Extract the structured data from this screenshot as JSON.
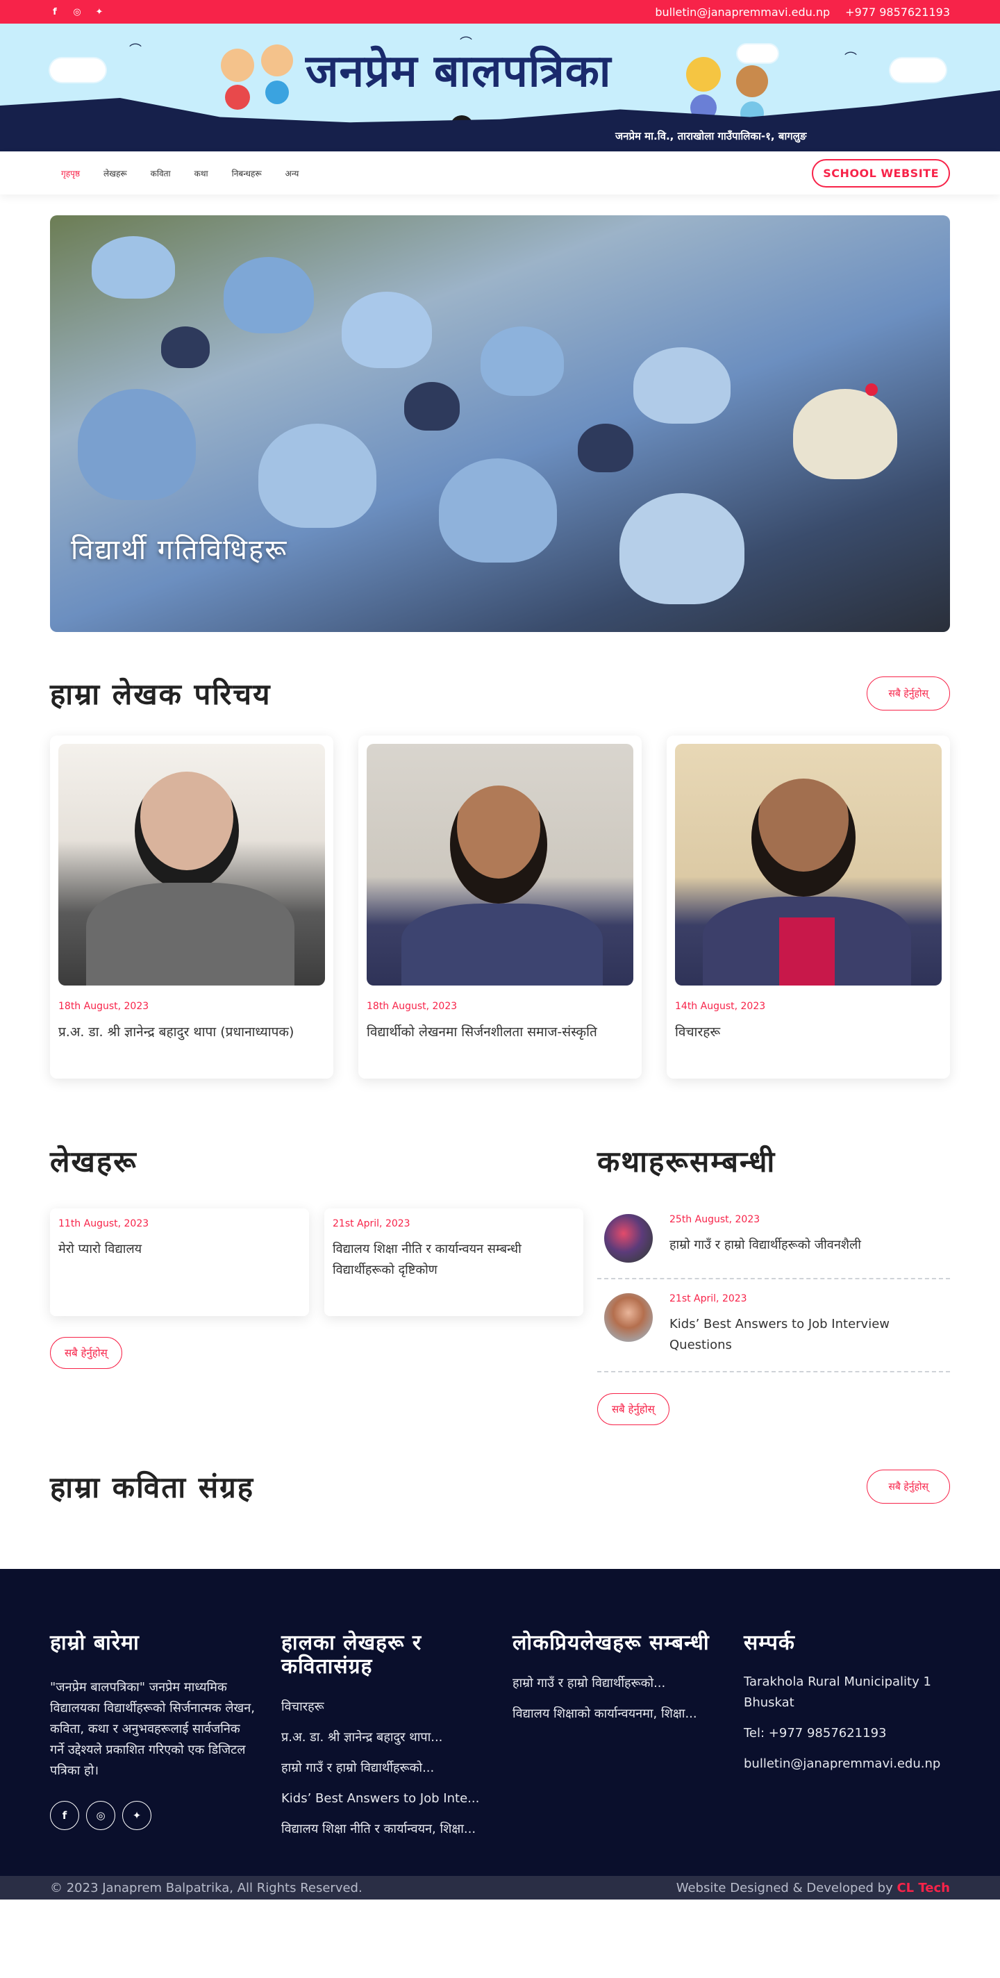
{
  "topbar": {
    "email": "bulletin@janapremmavi.edu.np",
    "phone": "+977 9857621193",
    "social_icons": [
      "facebook-icon",
      "instagram-icon",
      "twitter-icon"
    ]
  },
  "banner": {
    "title": "जनप्रेम बालपत्रिका",
    "subtitle": "जनप्रेम मा.वि., ताराखोला गाउँपालिका-१, बागलुङ"
  },
  "nav": {
    "items": [
      "गृहपृष्ठ",
      "लेखहरू",
      "कविता",
      "कथा",
      "निबन्धहरू",
      "अन्य"
    ],
    "active_index": 0,
    "school_button": "SCHOOL WEBSITE"
  },
  "hero": {
    "title": "विद्यार्थी गतिविधिहरू"
  },
  "featured": {
    "heading": "हाम्रा लेखक परिचय",
    "view_all": "सबै हेर्नुहोस्",
    "cards": [
      {
        "date": "18th August, 2023",
        "title": "प्र.अ. डा. श्री ज्ञानेन्द्र बहादुर थापा (प्रधानाध्यापक)"
      },
      {
        "date": "18th August, 2023",
        "title": "विद्यार्थीको लेखनमा सिर्जनशीलता समाज-संस्कृति"
      },
      {
        "date": "14th August, 2023",
        "title": "विचारहरू"
      }
    ]
  },
  "articles": {
    "heading": "लेखहरू",
    "view_all": "सबै हेर्नुहोस्",
    "cards": [
      {
        "date": "11th August, 2023",
        "title": "मेरो प्यारो विद्यालय"
      },
      {
        "date": "21st April, 2023",
        "title": "विद्यालय शिक्षा नीति र कार्यान्वयन सम्बन्धी विद्यार्थीहरूको दृष्टिकोण"
      }
    ]
  },
  "stories": {
    "heading": "कथाहरूसम्बन्धी",
    "view_all": "सबै हेर्नुहोस्",
    "items": [
      {
        "date": "25th August, 2023",
        "title": "हाम्रो गाउँ र हाम्रो विद्यार्थीहरूको जीवनशैली"
      },
      {
        "date": "21st April, 2023",
        "title": "Kids’ Best Answers to Job Interview Questions"
      }
    ]
  },
  "poems": {
    "heading": "हाम्रा कविता संग्रह",
    "view_all": "सबै हेर्नुहोस्"
  },
  "footer": {
    "about_heading": "हाम्रो बारेमा",
    "about_text": "\"जनप्रेम बालपत्रिका\" जनप्रेम माध्यमिक विद्यालयका विद्यार्थीहरूको सिर्जनात्मक लेखन, कविता, कथा र अनुभवहरूलाई सार्वजनिक गर्ने उद्देश्यले प्रकाशित गरिएको एक डिजिटल पत्रिका हो।",
    "social_icons": [
      "facebook-icon",
      "instagram-icon",
      "twitter-icon"
    ],
    "recent_heading": "हालका लेखहरू र कवितासंग्रह",
    "recent_links": [
      "विचारहरू",
      "प्र.अ. डा. श्री ज्ञानेन्द्र बहादुर थापा...",
      "हाम्रो गाउँ र हाम्रो विद्यार्थीहरूको...",
      "Kids’ Best Answers to Job Inte...",
      "विद्यालय शिक्षा नीति र कार्यान्वयन, शिक्षा..."
    ],
    "popular_heading": "लोकप्रियलेखहरू सम्बन्धी",
    "popular_links": [
      "हाम्रो गाउँ र हाम्रो विद्यार्थीहरूको...",
      "विद्यालय शिक्षाको कार्यान्वयनमा, शिक्षा..."
    ],
    "contact_heading": "सम्पर्क",
    "address": "Tarakhola Rural Municipality 1 Bhuskat",
    "tel": "Tel: +977 9857621193",
    "email": "bulletin@janapremmavi.edu.np",
    "copyright": "© 2023 Janaprem Balpatrika, All Rights Reserved.",
    "credit_prefix": "Website Designed & Developed by ",
    "credit_brand": "CL Tech"
  }
}
